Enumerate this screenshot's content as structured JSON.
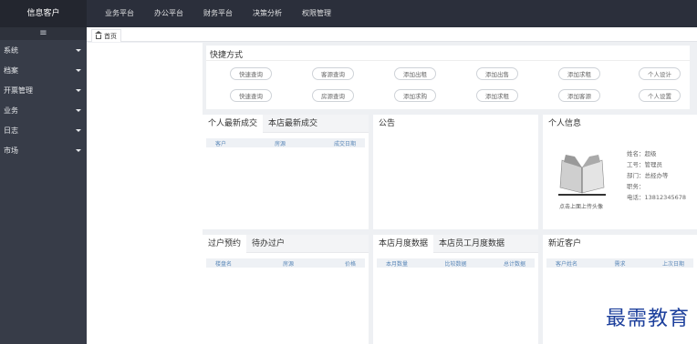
{
  "app": {
    "logo": "信息客户"
  },
  "topnav": [
    "业务平台",
    "办公平台",
    "财务平台",
    "决策分析",
    "权限管理"
  ],
  "sidebar": {
    "toggle": "≡",
    "items": [
      "系统",
      "档案",
      "开票管理",
      "业务",
      "日志",
      "市场"
    ]
  },
  "tab": {
    "label": "首页"
  },
  "quick": {
    "title": "快捷方式",
    "row1": [
      "快速查询",
      "客源查询",
      "添加出租",
      "添加出售",
      "添加求租",
      "个人设计"
    ],
    "row2": [
      "快速查询",
      "房源查询",
      "添加求购",
      "添加求租",
      "添加客源",
      "个人设置"
    ]
  },
  "deals": {
    "tabs": [
      "个人最新成交",
      "本店最新成交"
    ],
    "columns": [
      "客户",
      "房源",
      "成交日期"
    ]
  },
  "notice": {
    "title": "公告"
  },
  "profile": {
    "title": "个人信息",
    "caption": "点击上面上传头像",
    "rows": [
      "姓名：超级",
      "工号：管理员",
      "部门：总经办等",
      "职务：",
      "电话：13812345678"
    ]
  },
  "followups": {
    "tabs": [
      "过户预约",
      "待办过户"
    ],
    "columns": [
      "楼盘名",
      "房源",
      "价格"
    ]
  },
  "monthly": {
    "tabs": [
      "本店月度数据",
      "本店员工月度数据"
    ],
    "columns": [
      "本月数量",
      "比较数据",
      "总计数据"
    ]
  },
  "latest": {
    "title": "新近客户",
    "columns": [
      "客户姓名",
      "需求",
      "上次日期"
    ]
  },
  "watermark": "最需教育"
}
